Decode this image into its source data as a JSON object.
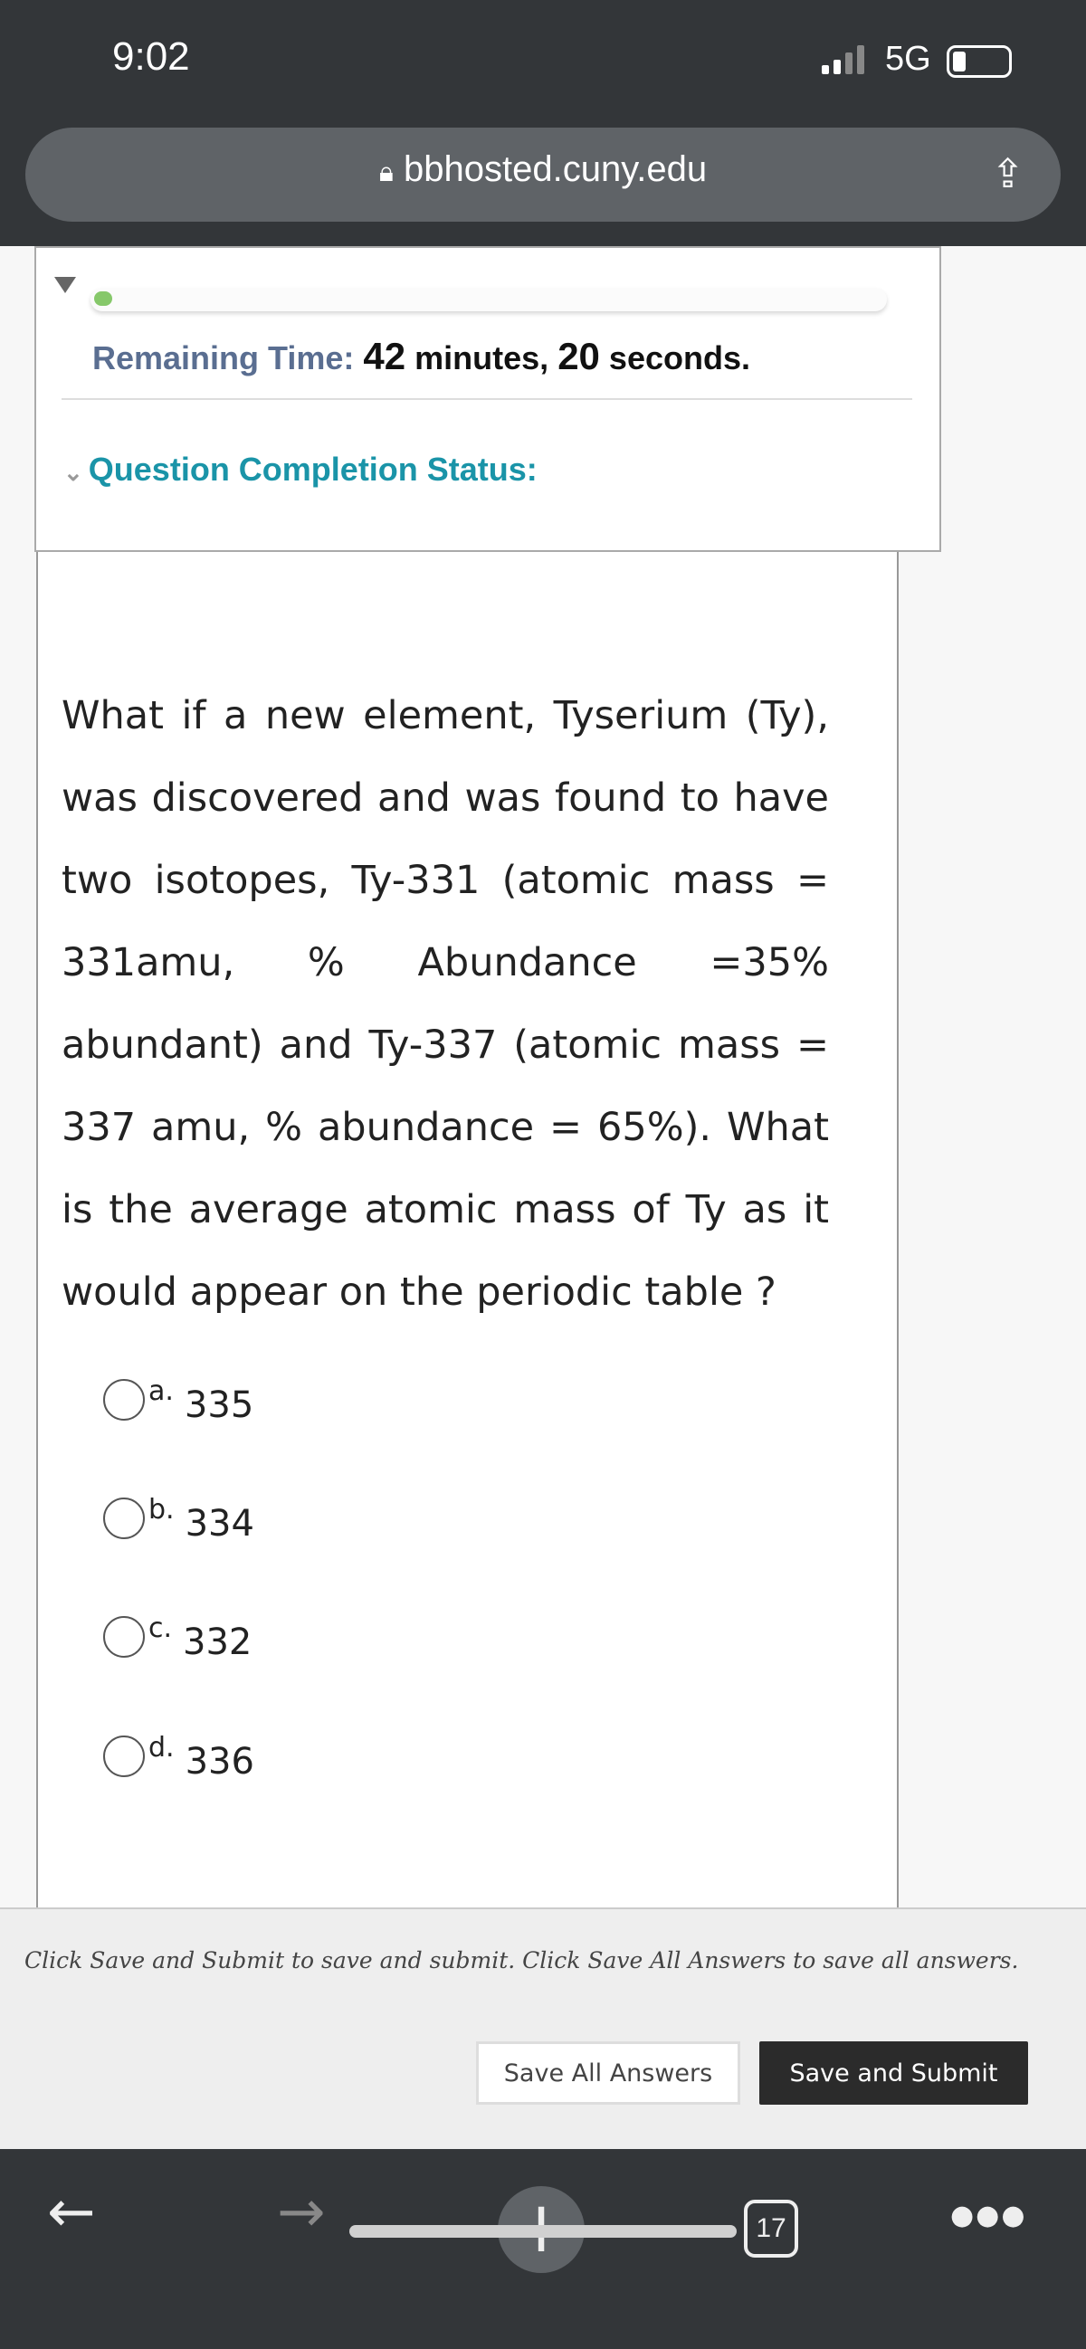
{
  "status_bar": {
    "time": "9:02",
    "network": "5G"
  },
  "browser": {
    "url": "bbhosted.cuny.edu",
    "tab_count": "17"
  },
  "timer": {
    "progress_percent": 2,
    "label": "Remaining Time:",
    "minutes": "42",
    "minutes_unit": "minutes,",
    "seconds": "20",
    "seconds_unit": "seconds."
  },
  "completion_status": {
    "label": "Question Completion Status:"
  },
  "question": {
    "text": "What if a new element, Tyserium (Ty), was discovered and was found to have two isotopes, Ty-331 (atomic mass = 331amu, % Abundance =35% abundant) and Ty-337 (atomic mass = 337 amu, % abundance = 65%). What is the average atomic mass of Ty as it would appear on the periodic table ?",
    "options": [
      {
        "letter": "a.",
        "value": "335"
      },
      {
        "letter": "b.",
        "value": "334"
      },
      {
        "letter": "c.",
        "value": "332"
      },
      {
        "letter": "d.",
        "value": "336"
      }
    ]
  },
  "footer": {
    "instructions": "Click Save and Submit to save and submit. Click Save All Answers to save all answers.",
    "save_all_label": "Save All Answers",
    "save_submit_label": "Save and Submit"
  },
  "colors": {
    "accent_teal": "#1a94a8",
    "label_slate": "#5a6e91",
    "progress_green": "#86c86a",
    "dark_button": "#2b2b2b"
  }
}
